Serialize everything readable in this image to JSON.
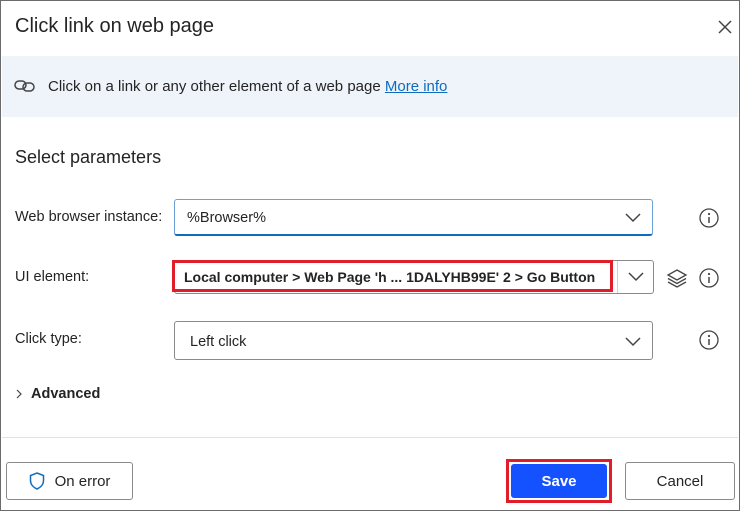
{
  "dialog": {
    "title": "Click link on web page"
  },
  "banner": {
    "description": "Click on a link or any other element of a web page",
    "more_info_label": "More info"
  },
  "section": {
    "title": "Select parameters"
  },
  "fields": {
    "browser": {
      "label": "Web browser instance:",
      "value": "%Browser%"
    },
    "ui_element": {
      "label": "UI element:",
      "value": "Local computer > Web Page 'h ... 1DALYHB99E' 2 > Go Button"
    },
    "click_type": {
      "label": "Click type:",
      "value": "Left click"
    }
  },
  "advanced": {
    "label": "Advanced"
  },
  "footer": {
    "on_error_label": "On error",
    "save_label": "Save",
    "cancel_label": "Cancel"
  },
  "colors": {
    "accent": "#1552ff",
    "highlight": "#e11d2a",
    "banner_bg": "#eff4fb",
    "link": "#0f6cbd"
  },
  "icons": {
    "close": "close-icon",
    "link": "link-icon",
    "chevron": "chevron-down-icon",
    "info": "info-icon",
    "layers": "layers-icon",
    "shield": "shield-icon"
  }
}
